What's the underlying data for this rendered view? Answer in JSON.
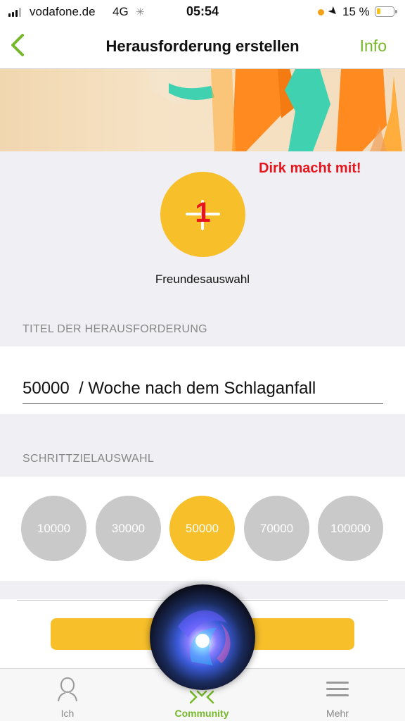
{
  "status_bar": {
    "carrier": "vodafone.de",
    "network": "4G",
    "time": "05:54",
    "battery_percent": "15 %",
    "battery_level": 0.15
  },
  "nav": {
    "title": "Herausforderung erstellen",
    "info_label": "Info"
  },
  "annotation": "Dirk macht mit!",
  "friends": {
    "badge_count": "1",
    "label": "Freundesauswahl"
  },
  "challenge_title": {
    "section_label": "TITEL DER HERAUSFORDERUNG",
    "value": "50000  / Woche nach dem Schlaganfall"
  },
  "step_goals": {
    "section_label": "SCHRITTZIELAUSWAHL",
    "options": [
      "10000",
      "30000",
      "50000",
      "70000",
      "100000"
    ],
    "selected": "50000"
  },
  "tabs": [
    {
      "label": "Ich",
      "icon": "person-icon",
      "active": false
    },
    {
      "label": "Community",
      "icon": "community-icon",
      "active": true
    },
    {
      "label": "Mehr",
      "icon": "menu-icon",
      "active": false
    }
  ],
  "colors": {
    "accent_green": "#76b82a",
    "accent_yellow": "#f7bf2a",
    "annotation_red": "#e8141c",
    "unselected_goal": "#c9c9c9"
  }
}
